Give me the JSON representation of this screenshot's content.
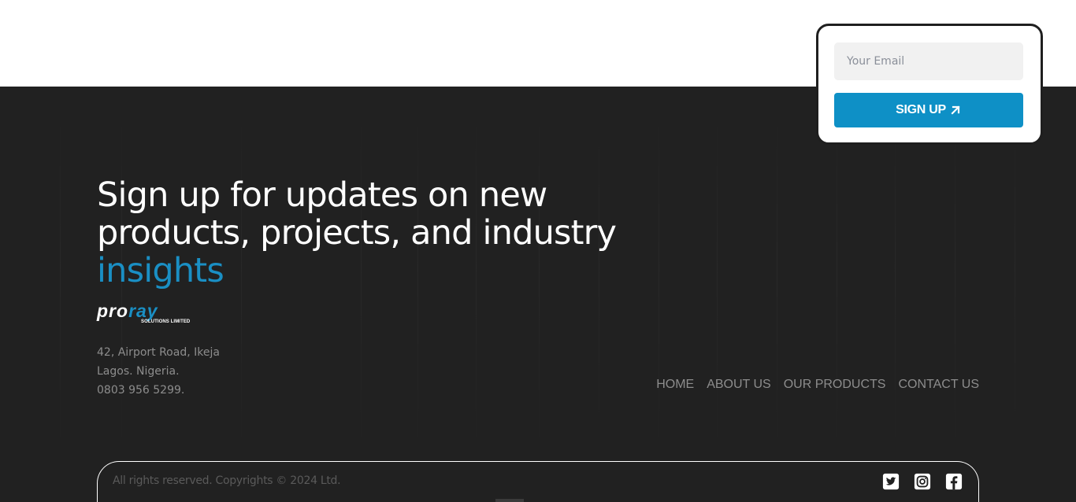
{
  "signup": {
    "email_placeholder": "Your Email",
    "button_label": "SIGN UP"
  },
  "headline": {
    "line1": "Sign up for updates on new",
    "line2": "products, projects, and industry",
    "accent": "insights"
  },
  "logo": {
    "pro": "pro",
    "ray": "ray",
    "sub": "SOLUTIONS LIMITED"
  },
  "address": {
    "line1": "42, Airport Road, Ikeja",
    "line2": "Lagos. Nigeria.",
    "phone": "0803 956 5299."
  },
  "nav": {
    "items": [
      {
        "label": "HOME"
      },
      {
        "label": "ABOUT US"
      },
      {
        "label": "OUR PRODUCTS"
      },
      {
        "label": "CONTACT US"
      }
    ]
  },
  "footer": {
    "copyright": "All rights reserved. Copyrights © 2024 Ltd."
  },
  "socials": [
    "twitter-icon",
    "instagram-icon",
    "facebook-icon"
  ],
  "colors": {
    "accent": "#0e90c6",
    "background_dark": "#212121",
    "muted_text": "#8d8d8d"
  }
}
